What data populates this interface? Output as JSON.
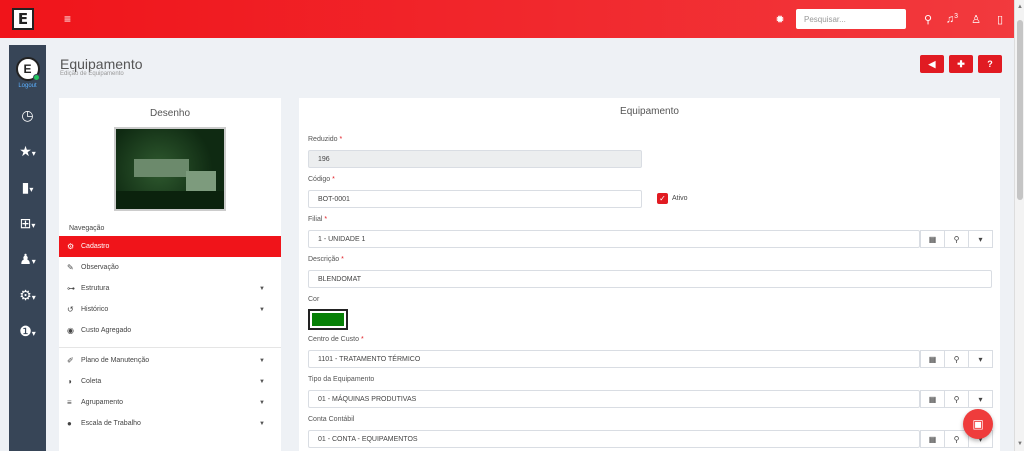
{
  "topbar": {
    "logo": "E",
    "menu_icon": "≡",
    "search_placeholder": "Pesquisar...",
    "notification_count": "3"
  },
  "sidebar": {
    "avatar_letter": "E",
    "logout": "Logout",
    "items": [
      {
        "icon": "dashboard-icon",
        "glyph": "◷"
      },
      {
        "icon": "star-icon",
        "glyph": "★"
      },
      {
        "icon": "file-icon",
        "glyph": "▮"
      },
      {
        "icon": "grid-icon",
        "glyph": "⊞"
      },
      {
        "icon": "user-plus-icon",
        "glyph": "👥"
      },
      {
        "icon": "cogs-icon",
        "glyph": "⚙"
      },
      {
        "icon": "info-icon",
        "glyph": "ℹ"
      }
    ]
  },
  "header": {
    "title": "Equipamento",
    "subtitle": "Edição de Equipamento"
  },
  "left": {
    "panel_title": "Desenho",
    "nav_heading": "Navegação",
    "nav_items": [
      {
        "label": "Cadastro",
        "icon": "cogs-icon",
        "glyph": "⚙",
        "active": true,
        "chevron": false
      },
      {
        "label": "Observação",
        "icon": "edit-icon",
        "glyph": "✎",
        "active": false,
        "chevron": false
      },
      {
        "label": "Estrutura",
        "icon": "sitemap-icon",
        "glyph": "⊶",
        "active": false,
        "chevron": true
      },
      {
        "label": "Histórico",
        "icon": "history-icon",
        "glyph": "↺",
        "active": false,
        "chevron": true
      },
      {
        "label": "Custo Agregado",
        "icon": "money-icon",
        "glyph": "◉",
        "active": false,
        "chevron": false
      }
    ],
    "nav_items2": [
      {
        "label": "Plano de Manutenção",
        "icon": "wrench-icon",
        "glyph": "✐",
        "chevron": true
      },
      {
        "label": "Coleta",
        "icon": "dashboard-icon",
        "glyph": "◑",
        "chevron": true
      },
      {
        "label": "Agrupamento",
        "icon": "list-icon",
        "glyph": "≡",
        "chevron": true
      },
      {
        "label": "Escala de Trabalho",
        "icon": "clock-icon",
        "glyph": "●",
        "chevron": true
      }
    ]
  },
  "form": {
    "title": "Equipamento",
    "reduzido_label": "Reduzido",
    "reduzido_value": "196",
    "codigo_label": "Código",
    "codigo_value": "BOT-0001",
    "ativo_label": "Ativo",
    "filial_label": "Filial",
    "filial_value": "1 - UNIDADE 1",
    "descricao_label": "Descrição",
    "descricao_value": "BLENDOMAT",
    "cor_label": "Cor",
    "cor_value": "#078007",
    "centro_label": "Centro de Custo",
    "centro_value": "1101 - TRATAMENTO TÉRMICO",
    "tipo_label": "Tipo da Equipamento",
    "tipo_value": "01 - MÁQUINAS PRODUTIVAS",
    "conta_label": "Conta Contábil",
    "conta_value": "01 - CONTA - EQUIPAMENTOS",
    "required_mark": "*"
  },
  "colors": {
    "accent": "#f0141a",
    "sidebar": "#374557",
    "swatch": "#078007"
  }
}
